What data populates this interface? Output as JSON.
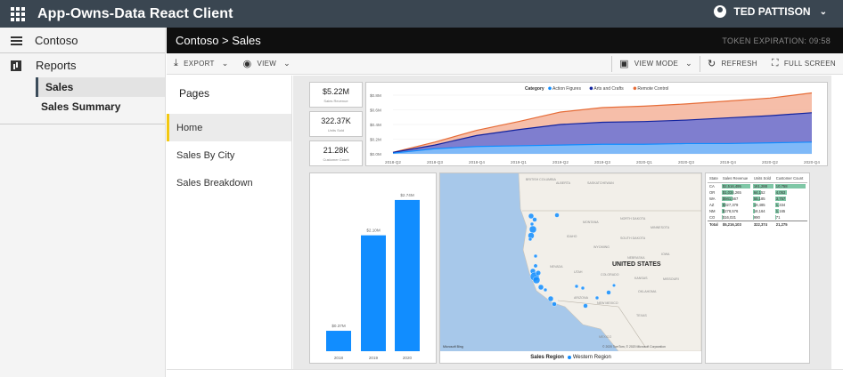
{
  "app": {
    "title": "App-Owns-Data React Client",
    "user": "TED PATTISON"
  },
  "sidebar": {
    "workspace": "Contoso",
    "reports_label": "Reports",
    "items": [
      {
        "label": "Sales",
        "active": true
      },
      {
        "label": "Sales Summary",
        "active": false
      }
    ]
  },
  "header": {
    "breadcrumb": "Contoso > Sales",
    "token": "TOKEN EXPIRATION: 09:58"
  },
  "toolbar": {
    "export": "EXPORT",
    "view": "VIEW",
    "view_mode": "VIEW MODE",
    "refresh": "REFRESH",
    "full_screen": "FULL SCREEN"
  },
  "pages": {
    "title": "Pages",
    "items": [
      {
        "label": "Home",
        "active": true
      },
      {
        "label": "Sales By City"
      },
      {
        "label": "Sales Breakdown"
      }
    ]
  },
  "kpis": [
    {
      "value": "$5.22M",
      "label": "Sales Revenue"
    },
    {
      "value": "322.37K",
      "label": "Units Sold"
    },
    {
      "value": "21.28K",
      "label": "Customer Count"
    }
  ],
  "colors": {
    "action": "#118dff",
    "arts": "#12239e",
    "remote": "#e66c37",
    "bars": "#118dff",
    "table_bar": "#7fc7a6"
  },
  "chart_data": [
    {
      "type": "area",
      "legend_title": "Category",
      "series": [
        {
          "name": "Action Figures",
          "values": [
            0.01,
            0.07,
            0.1,
            0.11,
            0.12,
            0.13,
            0.13,
            0.14,
            0.14,
            0.15,
            0.16
          ]
        },
        {
          "name": "Arts and Crafts",
          "values": [
            0.02,
            0.12,
            0.25,
            0.33,
            0.4,
            0.43,
            0.44,
            0.46,
            0.49,
            0.52,
            0.56
          ]
        },
        {
          "name": "Remote Control",
          "values": [
            0.02,
            0.16,
            0.32,
            0.44,
            0.57,
            0.63,
            0.65,
            0.68,
            0.72,
            0.76,
            0.83
          ]
        }
      ],
      "categories": [
        "2018-Q2",
        "2018-Q3",
        "2018-Q4",
        "2019-Q1",
        "2019-Q2",
        "2019-Q3",
        "2020-Q1",
        "2020-Q3",
        "2019-Q4",
        "2020-Q2",
        "2020-Q4"
      ],
      "y_ticks": [
        "$0.0M",
        "$0.2M",
        "$0.4M",
        "$0.6M",
        "$0.8M"
      ],
      "ylim": [
        0,
        0.8
      ]
    },
    {
      "type": "bar",
      "categories": [
        "2018",
        "2019",
        "2020"
      ],
      "values": [
        0.37,
        2.1,
        2.74
      ],
      "labels": [
        "$0.37M",
        "$2.10M",
        "$2.74M"
      ],
      "ylim": [
        0,
        2.9
      ]
    }
  ],
  "map": {
    "country_label": "UNITED STATES",
    "legend_title": "Sales Region",
    "legend_item": "Western Region",
    "attribution": "© 2020 TomTom, © 2020 Microsoft Corporation",
    "places": [
      "BRITISH COLUMBIA",
      "ALBERTA",
      "SASKATCHEWAN",
      "MONTANA",
      "NORTH DAKOTA",
      "SOUTH DAKOTA",
      "MINNESOTA",
      "WYOMING",
      "IDAHO",
      "NEVADA",
      "UTAH",
      "COLORADO",
      "NEBRASKA",
      "IOWA",
      "KANSAS",
      "MISSOURI",
      "OKLAHOMA",
      "ARIZONA",
      "NEW MEXICO",
      "TEXAS",
      "MEXICO"
    ]
  },
  "table": {
    "headers": [
      "State",
      "Sales Revenue",
      "Units Sold",
      "Customer Count"
    ],
    "rows": [
      {
        "state": "CA",
        "rev": "$2,516,495",
        "units": "161,288",
        "cust": "10,758",
        "f1": 1.0,
        "f2": 1.0,
        "f3": 1.0
      },
      {
        "state": "OR",
        "rev": "$1,034,265",
        "units": "64,152",
        "cust": "4,053",
        "f1": 0.41,
        "f2": 0.4,
        "f3": 0.38
      },
      {
        "state": "WA",
        "rev": "$941,567",
        "units": "55,185",
        "cust": "3,757",
        "f1": 0.37,
        "f2": 0.34,
        "f3": 0.35
      },
      {
        "state": "AZ",
        "rev": "$327,379",
        "units": "19,485",
        "cust": "1,334",
        "f1": 0.13,
        "f2": 0.12,
        "f3": 0.12
      },
      {
        "state": "NM",
        "rev": "$278,576",
        "units": "18,164",
        "cust": "1,165",
        "f1": 0.11,
        "f2": 0.11,
        "f3": 0.11
      },
      {
        "state": "CO",
        "rev": "$16,021",
        "units": "990",
        "cust": "71",
        "f1": 0.01,
        "f2": 0.01,
        "f3": 0.01
      }
    ],
    "total": {
      "label": "Total",
      "rev": "$5,216,103",
      "units": "322,374",
      "cust": "21,275"
    }
  }
}
